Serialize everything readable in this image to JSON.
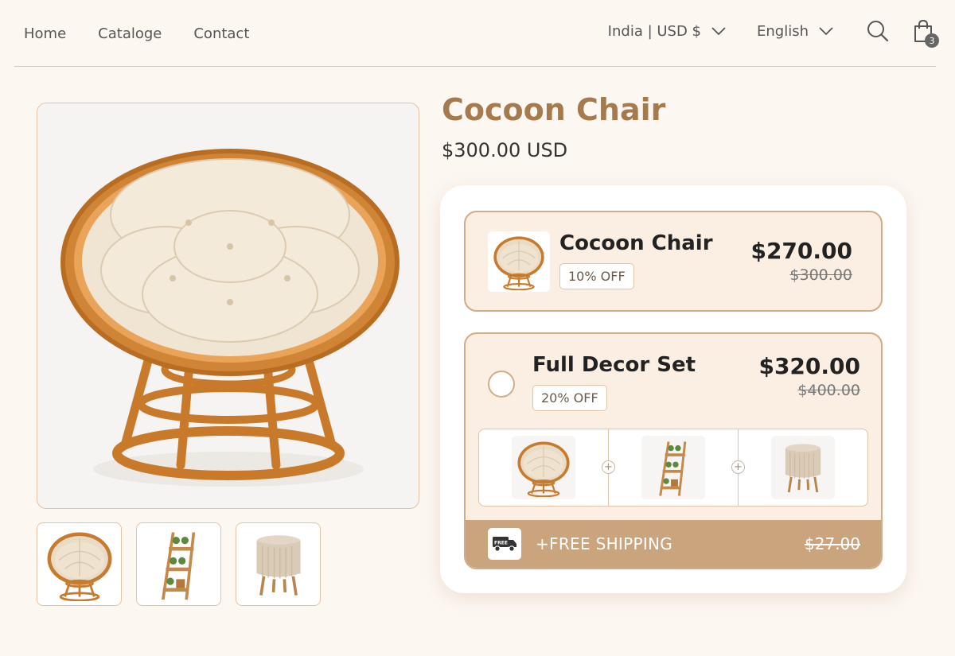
{
  "nav": {
    "links": [
      "Home",
      "Cataloge",
      "Contact"
    ],
    "region": "India | USD $",
    "language": "English",
    "cart_count": "3"
  },
  "product": {
    "title": "Cocoon Chair",
    "price": "$300.00 USD"
  },
  "gallery": {
    "main_image": "cocoon-chair-photo",
    "thumbnails": [
      "cocoon-chair",
      "plant-ladder-shelf",
      "round-ottoman-stool"
    ]
  },
  "bundle": {
    "option1": {
      "name": "Cocoon Chair",
      "badge": "10% OFF",
      "price_new": "$270.00",
      "price_old": "$300.00"
    },
    "option2": {
      "name": "Full Decor Set",
      "badge": "20% OFF",
      "price_new": "$320.00",
      "price_old": "$400.00",
      "items": [
        "cocoon-chair",
        "plant-ladder-shelf",
        "round-ottoman-stool"
      ],
      "truck_label": "FREE",
      "shipping_label": "+FREE SHIPPING",
      "shipping_old": "$27.00"
    }
  },
  "colors": {
    "accent": "#a57a4d",
    "border": "#d0ad88",
    "option_bg": "#fbeee3",
    "shipping_bar": "#c9a47c"
  }
}
